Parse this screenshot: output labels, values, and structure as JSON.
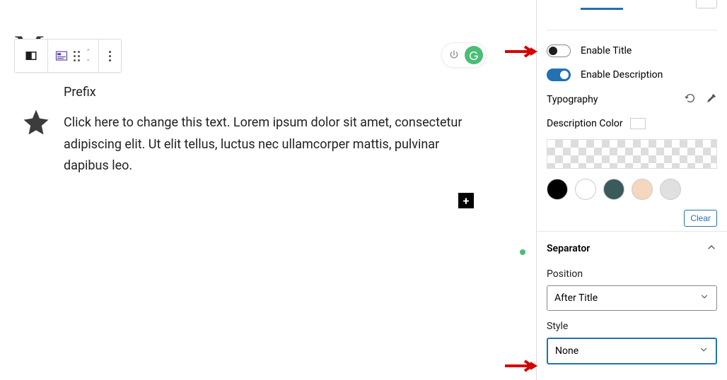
{
  "editor": {
    "hidden_title": "M                     t",
    "prefix_label": "Prefix",
    "description_text": "Click here to change this text. Lorem ipsum dolor sit amet, consectetur adipiscing elit. Ut elit tellus, luctus nec ullamcorper mattis, pulvinar dapibus leo."
  },
  "sidebar": {
    "enable_title": {
      "label": "Enable Title",
      "value": false
    },
    "enable_description": {
      "label": "Enable Description",
      "value": true
    },
    "typography_label": "Typography",
    "description_color_label": "Description Color",
    "swatches": [
      "#000000",
      "#ffffff",
      "#3a5a5c",
      "#f5d7bd",
      "#e0e0e0"
    ],
    "clear_label": "Clear",
    "separator": {
      "title": "Separator",
      "position_label": "Position",
      "position_value": "After Title",
      "style_label": "Style",
      "style_value": "None"
    }
  }
}
